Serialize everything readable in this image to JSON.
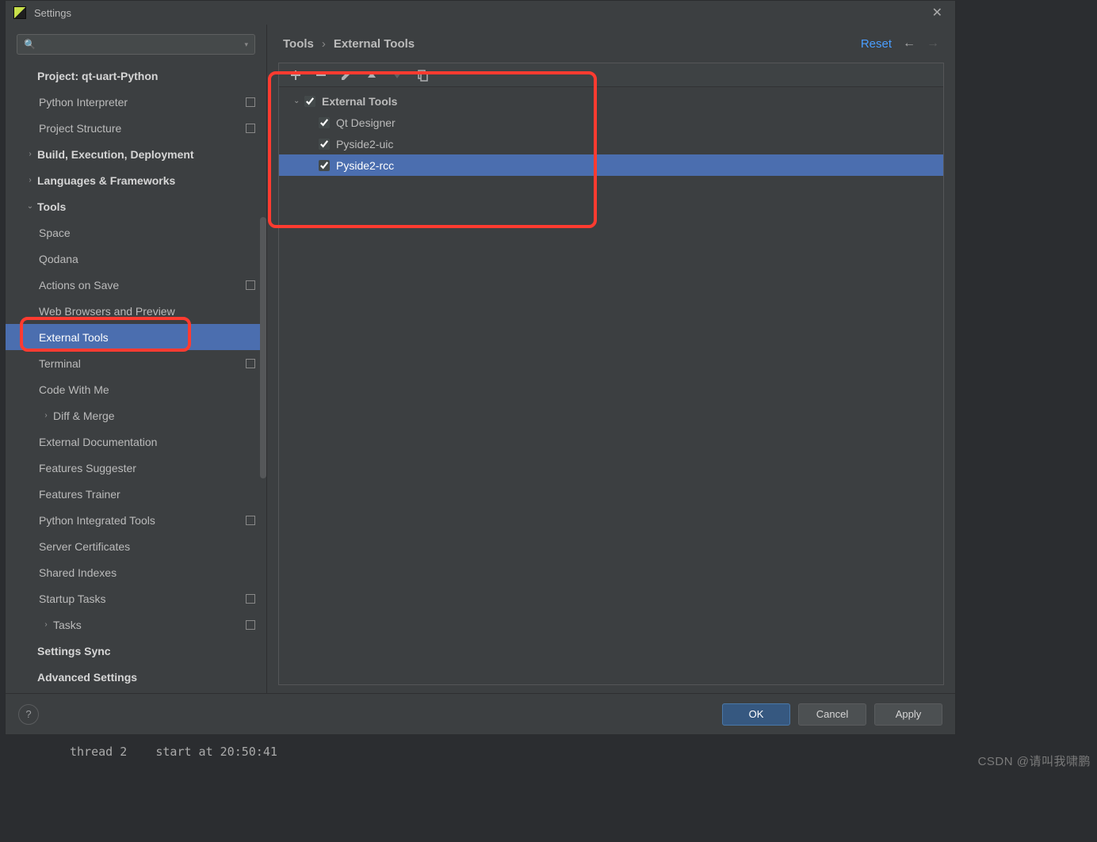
{
  "window": {
    "title": "Settings",
    "close_tooltip": "Close"
  },
  "search": {
    "placeholder": ""
  },
  "sidebar": {
    "items": [
      {
        "label": "Project: qt-uart-Python",
        "bold": true,
        "depth": 1,
        "chev": "",
        "repo": false
      },
      {
        "label": "Python Interpreter",
        "bold": false,
        "depth": 2,
        "chev": "",
        "repo": true
      },
      {
        "label": "Project Structure",
        "bold": false,
        "depth": 2,
        "chev": "",
        "repo": true
      },
      {
        "label": "Build, Execution, Deployment",
        "bold": true,
        "depth": 1,
        "chev": "›",
        "repo": false
      },
      {
        "label": "Languages & Frameworks",
        "bold": true,
        "depth": 1,
        "chev": "›",
        "repo": false
      },
      {
        "label": "Tools",
        "bold": true,
        "depth": 1,
        "chev": "⌄",
        "repo": false
      },
      {
        "label": "Space",
        "bold": false,
        "depth": 2,
        "chev": "",
        "repo": false
      },
      {
        "label": "Qodana",
        "bold": false,
        "depth": 2,
        "chev": "",
        "repo": false
      },
      {
        "label": "Actions on Save",
        "bold": false,
        "depth": 2,
        "chev": "",
        "repo": true
      },
      {
        "label": "Web Browsers and Preview",
        "bold": false,
        "depth": 2,
        "chev": "",
        "repo": false
      },
      {
        "label": "External Tools",
        "bold": false,
        "depth": 2,
        "chev": "",
        "repo": false,
        "selected": true
      },
      {
        "label": "Terminal",
        "bold": false,
        "depth": 2,
        "chev": "",
        "repo": true
      },
      {
        "label": "Code With Me",
        "bold": false,
        "depth": 2,
        "chev": "",
        "repo": false
      },
      {
        "label": "Diff & Merge",
        "bold": false,
        "depth": 2,
        "chev": "›",
        "repo": false
      },
      {
        "label": "External Documentation",
        "bold": false,
        "depth": 2,
        "chev": "",
        "repo": false
      },
      {
        "label": "Features Suggester",
        "bold": false,
        "depth": 2,
        "chev": "",
        "repo": false
      },
      {
        "label": "Features Trainer",
        "bold": false,
        "depth": 2,
        "chev": "",
        "repo": false
      },
      {
        "label": "Python Integrated Tools",
        "bold": false,
        "depth": 2,
        "chev": "",
        "repo": true
      },
      {
        "label": "Server Certificates",
        "bold": false,
        "depth": 2,
        "chev": "",
        "repo": false
      },
      {
        "label": "Shared Indexes",
        "bold": false,
        "depth": 2,
        "chev": "",
        "repo": false
      },
      {
        "label": "Startup Tasks",
        "bold": false,
        "depth": 2,
        "chev": "",
        "repo": true
      },
      {
        "label": "Tasks",
        "bold": false,
        "depth": 2,
        "chev": "›",
        "repo": true
      },
      {
        "label": "Settings Sync",
        "bold": true,
        "depth": 1,
        "chev": "",
        "repo": false
      },
      {
        "label": "Advanced Settings",
        "bold": true,
        "depth": 1,
        "chev": "",
        "repo": false
      }
    ]
  },
  "breadcrumb": {
    "crumb1": "Tools",
    "crumb2": "External Tools",
    "reset": "Reset"
  },
  "toolbar": {
    "add": "+",
    "remove": "−",
    "edit": "edit",
    "up": "▲",
    "down": "▼",
    "copy": "copy"
  },
  "tool_tree": {
    "group": {
      "label": "External Tools",
      "checked": true,
      "expanded": true
    },
    "items": [
      {
        "label": "Qt Designer",
        "checked": true,
        "selected": false
      },
      {
        "label": "Pyside2-uic",
        "checked": true,
        "selected": false
      },
      {
        "label": "Pyside2-rcc",
        "checked": true,
        "selected": true
      }
    ]
  },
  "footer": {
    "ok": "OK",
    "cancel": "Cancel",
    "apply": "Apply",
    "help": "?"
  },
  "watermark": "CSDN @请叫我啸鹏",
  "console_bg": "thread 2    start at 20:50:41"
}
